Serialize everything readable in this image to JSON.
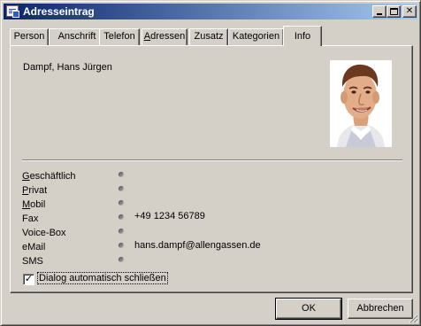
{
  "window": {
    "title": "Adresseintrag",
    "controls": {
      "minimize": "_",
      "maximize": "□",
      "close": "✕"
    }
  },
  "tabs": [
    {
      "label": "Person",
      "mnemonic": ""
    },
    {
      "label": "Anschrift",
      "mnemonic": ""
    },
    {
      "label": "Telefon",
      "mnemonic": ""
    },
    {
      "label": "Adressen",
      "mnemonic": "A"
    },
    {
      "label": "Zusatz",
      "mnemonic": ""
    },
    {
      "label": "Kategorien",
      "mnemonic": ""
    },
    {
      "label": "Info",
      "mnemonic": "",
      "active": true
    }
  ],
  "info": {
    "name": "Dampf, Hans Jürgen",
    "photo_alt": "contact-photo",
    "rows": [
      {
        "key": "geschaeftlich",
        "label": "Geschäftlich",
        "mnemonic": "G",
        "rest": "eschäftlich",
        "value": ""
      },
      {
        "key": "privat",
        "label": "Privat",
        "mnemonic": "P",
        "rest": "rivat",
        "value": ""
      },
      {
        "key": "mobil",
        "label": "Mobil",
        "mnemonic": "M",
        "rest": "obil",
        "value": ""
      },
      {
        "key": "fax",
        "label": "Fax",
        "mnemonic": "",
        "rest": "Fax",
        "value": "+49 1234 56789"
      },
      {
        "key": "voicebox",
        "label": "Voice-Box",
        "mnemonic": "",
        "rest": "Voice-Box",
        "value": ""
      },
      {
        "key": "email",
        "label": "eMail",
        "mnemonic": "",
        "rest": "eMail",
        "value": "hans.dampf@allengassen.de"
      },
      {
        "key": "sms",
        "label": "SMS",
        "mnemonic": "",
        "rest": "SMS",
        "value": ""
      }
    ]
  },
  "checkbox": {
    "label": "Dialog automatisch schließen",
    "checked": true,
    "mark": "✓"
  },
  "buttons": {
    "ok": "OK",
    "cancel": "Abbrechen"
  },
  "colors": {
    "face": "#d4d0c8",
    "title_start": "#0a246a",
    "title_end": "#a6caf0"
  }
}
